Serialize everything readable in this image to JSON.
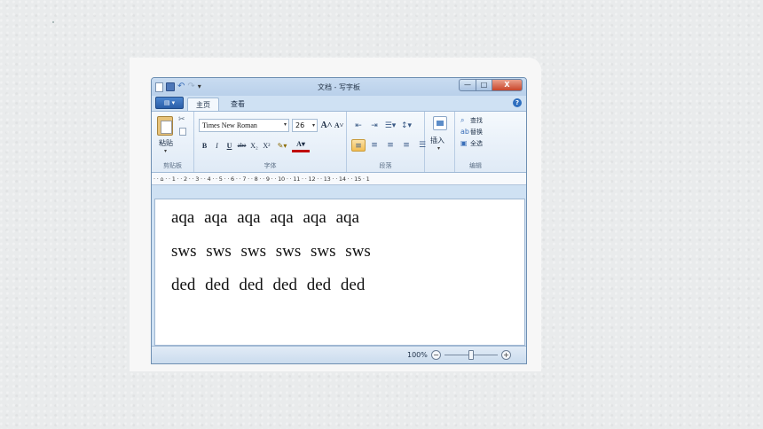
{
  "window": {
    "title": "文档 - 写字板",
    "app_button": "▤ ▾",
    "undo_glyph": "↶",
    "redo_glyph": "↷",
    "qa_more": "▾",
    "min_glyph": "—",
    "max_glyph": "□",
    "close_glyph": "X"
  },
  "tabs": [
    {
      "label": "主页",
      "active": true
    },
    {
      "label": "查看",
      "active": false
    }
  ],
  "help_glyph": "?",
  "ribbon": {
    "clipboard": {
      "label": "剪贴板",
      "paste_label": "粘贴",
      "paste_arrow": "▾",
      "cut_glyph": "✂"
    },
    "font": {
      "label": "字体",
      "font_name": "Times New Roman",
      "font_size": "26",
      "dd_glyph": "▾",
      "grow": "A˄",
      "shrink": "A˅",
      "bold": "B",
      "italic": "I",
      "underline": "U",
      "strike": "abe",
      "subscript": "X₂",
      "superscript": "X²",
      "highlight": "✎▾",
      "font_color": "A▾"
    },
    "paragraph": {
      "label": "段落",
      "top": [
        "⇤",
        "⇥",
        "☰▾",
        "↕▾"
      ],
      "bottom": [
        "≡",
        "≡",
        "≡",
        "≡",
        "☰"
      ]
    },
    "insert": {
      "label": "插入",
      "arrow": "▾"
    },
    "editing": {
      "label": "编辑",
      "find": "查找",
      "find_glyph": "⌕",
      "replace": "替换",
      "replace_glyph": "ab",
      "select_all": "全选",
      "select_glyph": "▣"
    }
  },
  "ruler": "·  ·  ⌂  ·  ·  1  ·  ·  2  ·  ·  3  ·  ·  4  ·  ·  5  ·  ·  6  ·  ·  7  ·  ·  8  ·  ·  9  ·  ·  10  ·  ·  11  ·  ·  12  ·  ·  13  ·  ·  14  ·  ·  15  ·  1",
  "document": {
    "lines": [
      "aqa  aqa  aqa  aqa  aqa  aqa",
      "sws  sws  sws  sws  sws  sws",
      "ded  ded  ded  ded  ded  ded"
    ]
  },
  "status": {
    "zoom": "100%",
    "zoom_out": "−",
    "zoom_in": "+",
    "zoom_level": 0.5
  }
}
